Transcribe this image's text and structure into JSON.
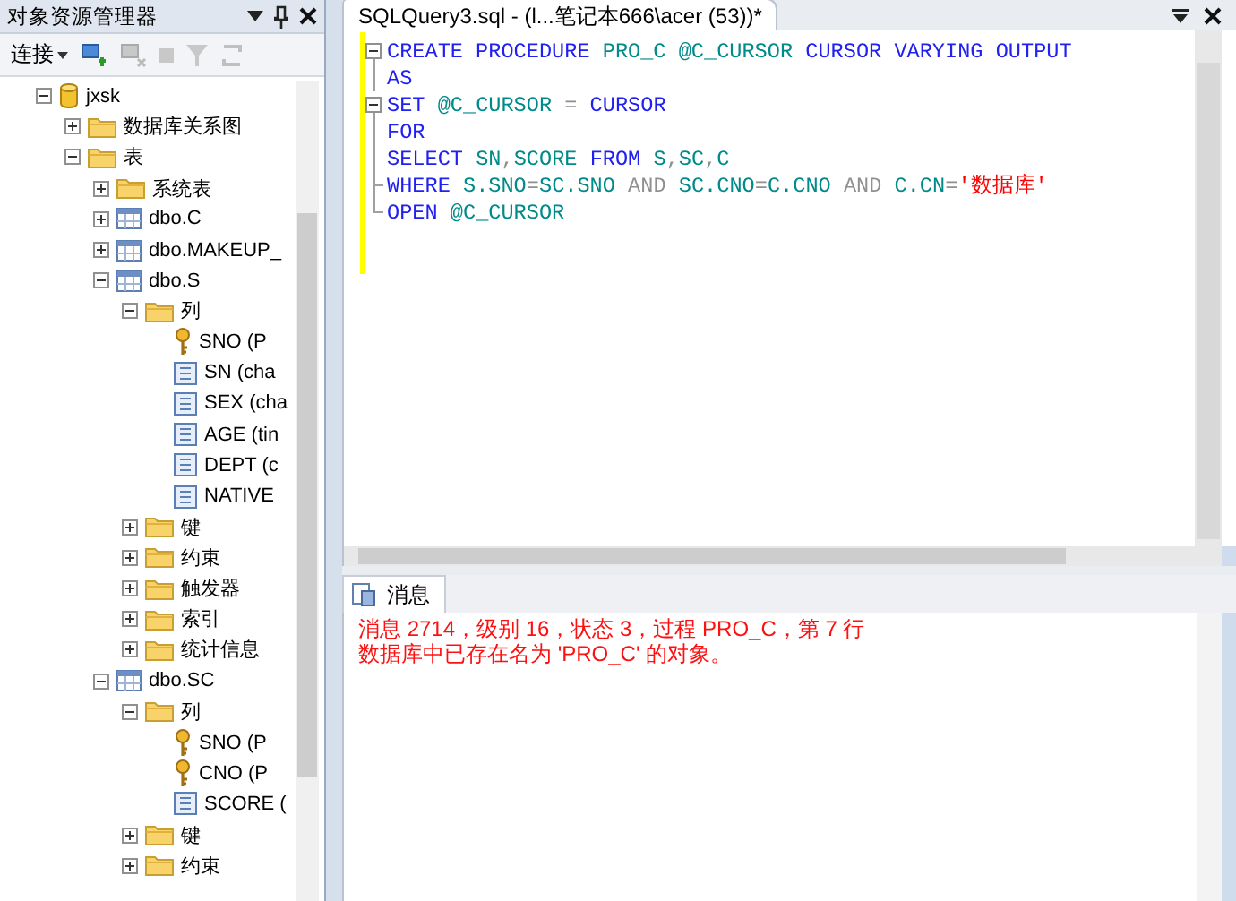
{
  "explorer": {
    "title": "对象资源管理器",
    "connect_label": "连接",
    "tree": [
      {
        "label": "jxsk",
        "kind": "database",
        "expanded": true,
        "children": [
          {
            "label": "数据库关系图",
            "kind": "folder",
            "expanded": false
          },
          {
            "label": "表",
            "kind": "folder",
            "expanded": true,
            "children": [
              {
                "label": "系统表",
                "kind": "folder",
                "expanded": false
              },
              {
                "label": "dbo.C",
                "kind": "table",
                "expanded": false
              },
              {
                "label": "dbo.MAKEUP_",
                "kind": "table",
                "expanded": false
              },
              {
                "label": "dbo.S",
                "kind": "table",
                "expanded": true,
                "children": [
                  {
                    "label": "列",
                    "kind": "folder",
                    "expanded": true,
                    "children": [
                      {
                        "label": "SNO (P",
                        "kind": "key-column"
                      },
                      {
                        "label": "SN (cha",
                        "kind": "column"
                      },
                      {
                        "label": "SEX (cha",
                        "kind": "column"
                      },
                      {
                        "label": "AGE (tin",
                        "kind": "column"
                      },
                      {
                        "label": "DEPT (c",
                        "kind": "column"
                      },
                      {
                        "label": "NATIVE",
                        "kind": "column"
                      }
                    ]
                  },
                  {
                    "label": "键",
                    "kind": "folder",
                    "expanded": false
                  },
                  {
                    "label": "约束",
                    "kind": "folder",
                    "expanded": false
                  },
                  {
                    "label": "触发器",
                    "kind": "folder",
                    "expanded": false
                  },
                  {
                    "label": "索引",
                    "kind": "folder",
                    "expanded": false
                  },
                  {
                    "label": "统计信息",
                    "kind": "folder",
                    "expanded": false
                  }
                ]
              },
              {
                "label": "dbo.SC",
                "kind": "table",
                "expanded": true,
                "children": [
                  {
                    "label": "列",
                    "kind": "folder",
                    "expanded": true,
                    "children": [
                      {
                        "label": "SNO (P",
                        "kind": "key-column"
                      },
                      {
                        "label": "CNO (P",
                        "kind": "key-column"
                      },
                      {
                        "label": "SCORE (",
                        "kind": "column"
                      }
                    ]
                  },
                  {
                    "label": "键",
                    "kind": "folder",
                    "expanded": false
                  },
                  {
                    "label": "约束",
                    "kind": "folder",
                    "expanded": false
                  }
                ]
              }
            ]
          }
        ]
      }
    ]
  },
  "editor": {
    "tab": {
      "title": "SQLQuery3.sql - (l...笔记本666\\acer (53))*",
      "selected": true
    },
    "lines": [
      {
        "kind": "collapse",
        "tokens": [
          {
            "text": "CREATE PROCEDURE ",
            "kind": "keyword"
          },
          {
            "text": "PRO_C @C_CURSOR ",
            "kind": "ident"
          },
          {
            "text": "CURSOR VARYING OUTPUT",
            "kind": "keyword"
          }
        ]
      },
      {
        "kind": "line",
        "tokens": [
          {
            "text": "AS",
            "kind": "keyword"
          }
        ]
      },
      {
        "kind": "collapse",
        "tokens": [
          {
            "text": "SET ",
            "kind": "keyword"
          },
          {
            "text": "@C_CURSOR ",
            "kind": "ident"
          },
          {
            "text": "= ",
            "kind": "op"
          },
          {
            "text": "CURSOR",
            "kind": "keyword"
          }
        ]
      },
      {
        "kind": "line",
        "tokens": [
          {
            "text": "FOR",
            "kind": "keyword"
          }
        ]
      },
      {
        "kind": "line",
        "tokens": [
          {
            "text": "SELECT ",
            "kind": "keyword"
          },
          {
            "text": "SN",
            "kind": "ident"
          },
          {
            "text": ",",
            "kind": "op"
          },
          {
            "text": "SCORE ",
            "kind": "ident"
          },
          {
            "text": "FROM ",
            "kind": "keyword"
          },
          {
            "text": "S",
            "kind": "ident"
          },
          {
            "text": ",",
            "kind": "op"
          },
          {
            "text": "SC",
            "kind": "ident"
          },
          {
            "text": ",",
            "kind": "op"
          },
          {
            "text": "C",
            "kind": "ident"
          }
        ]
      },
      {
        "kind": "branch",
        "tokens": [
          {
            "text": "WHERE ",
            "kind": "keyword"
          },
          {
            "text": "S.SNO",
            "kind": "ident"
          },
          {
            "text": "=",
            "kind": "op"
          },
          {
            "text": "SC.SNO ",
            "kind": "ident"
          },
          {
            "text": "AND ",
            "kind": "op"
          },
          {
            "text": "SC.CNO",
            "kind": "ident"
          },
          {
            "text": "=",
            "kind": "op"
          },
          {
            "text": "C.CNO ",
            "kind": "ident"
          },
          {
            "text": "AND ",
            "kind": "op"
          },
          {
            "text": "C.CN",
            "kind": "ident"
          },
          {
            "text": "=",
            "kind": "op"
          },
          {
            "text": "'数据库'",
            "kind": "string"
          }
        ]
      },
      {
        "kind": "end",
        "tokens": [
          {
            "text": "OPEN ",
            "kind": "keyword"
          },
          {
            "text": "@C_CURSOR",
            "kind": "ident"
          }
        ]
      }
    ]
  },
  "messages": {
    "tab": {
      "label": "消息",
      "selected": true
    },
    "lines": [
      "消息 2714，级别 16，状态 3，过程 PRO_C，第 7 行",
      "数据库中已存在名为 'PRO_C' 的对象。"
    ]
  }
}
